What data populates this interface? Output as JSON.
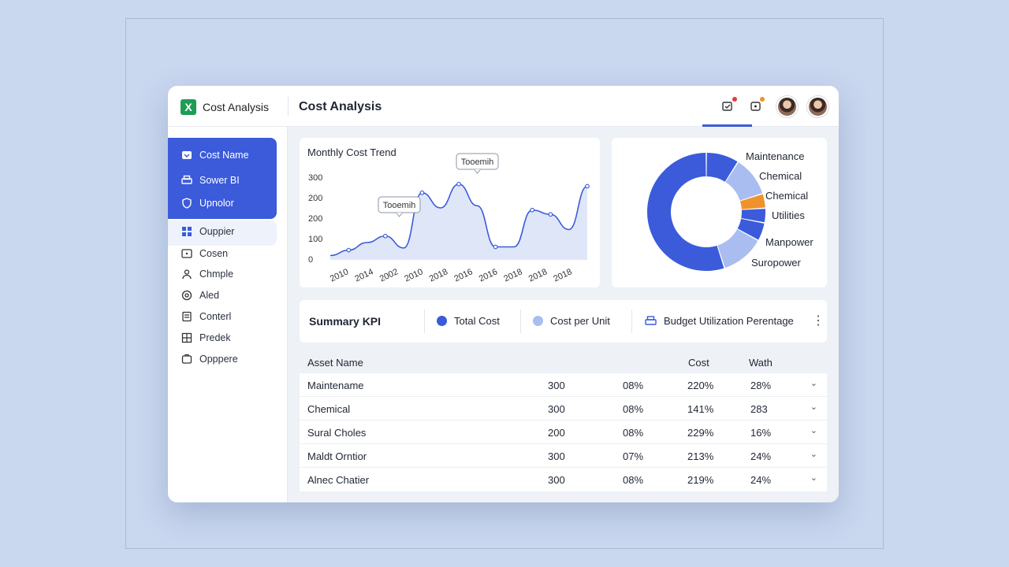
{
  "header": {
    "app_name": "Cost Analysis",
    "page_title": "Cost Analysis",
    "icons": [
      "checkbox-icon",
      "notification-icon"
    ],
    "accent": "#3b5bdb"
  },
  "sidebar": {
    "items": [
      {
        "label": "Cost Name",
        "icon": "tag-icon",
        "active": true
      },
      {
        "label": "Sower BI",
        "icon": "print-icon",
        "active": true
      },
      {
        "label": "Upnolor",
        "icon": "shield-icon",
        "active": true
      },
      {
        "label": "Ouppier",
        "icon": "grid-icon",
        "active": false
      },
      {
        "label": "Cosen",
        "icon": "plus-square-icon",
        "active": false
      },
      {
        "label": "Chmple",
        "icon": "user-icon",
        "active": false
      },
      {
        "label": "Aled",
        "icon": "badge-icon",
        "active": false
      },
      {
        "label": "Conterl",
        "icon": "doc-icon",
        "active": false
      },
      {
        "label": "Predek",
        "icon": "table-icon",
        "active": false
      },
      {
        "label": "Opppere",
        "icon": "box-icon",
        "active": false
      }
    ]
  },
  "trend_chart": {
    "title": "Monthly Cost Trend",
    "y_ticks": [
      "300",
      "200",
      "200",
      "100",
      "0"
    ],
    "x_ticks": [
      "2010",
      "2014",
      "2002",
      "2010",
      "2018",
      "2016",
      "2016",
      "2018",
      "2018",
      "2018"
    ],
    "tooltip_1": "Tooemih",
    "tooltip_2": "Tooemih",
    "line_color": "#3b5bdb"
  },
  "chart_data": {
    "type": "area",
    "x": [
      0,
      1,
      2,
      3,
      4,
      5,
      6,
      7,
      8,
      9,
      10,
      11,
      12,
      13,
      14
    ],
    "values": [
      20,
      45,
      80,
      110,
      55,
      310,
      240,
      350,
      250,
      60,
      60,
      230,
      210,
      140,
      340
    ],
    "ylim": [
      0,
      400
    ],
    "donut": {
      "segments": [
        {
          "label": "Maintenance",
          "value": 9,
          "color": "#3b5bdb"
        },
        {
          "label": "Chemical",
          "value": 11,
          "color": "#a9bdf0"
        },
        {
          "label": "Chemical",
          "value": 4,
          "color": "#f0922b"
        },
        {
          "label": "Utilities",
          "value": 4,
          "color": "#3b5bdb"
        },
        {
          "label": "",
          "value": 5,
          "color": "#3b5bdb"
        },
        {
          "label": "Manpower",
          "value": 12,
          "color": "#a9bdf0"
        },
        {
          "label": "Suropower",
          "value": 55,
          "color": "#3b5bdb"
        }
      ]
    }
  },
  "kpi": {
    "title": "Summary KPI",
    "items": [
      {
        "label": "Total Cost",
        "color": "#3b5bdb"
      },
      {
        "label": "Cost per Unit",
        "color": "#a9bdf0"
      },
      {
        "label": "Budget Utilization Perentage",
        "icon": "print-icon"
      }
    ]
  },
  "table": {
    "headers": [
      "Asset Name",
      "Cost",
      "Wath"
    ],
    "rows": [
      [
        "Maintename",
        "300",
        "08%",
        "220%",
        "28%"
      ],
      [
        "Chemical",
        "300",
        "08%",
        "141%",
        "283"
      ],
      [
        "Sural Choles",
        "200",
        "08%",
        "229%",
        "16%"
      ],
      [
        "Maldt Orntior",
        "300",
        "07%",
        "213%",
        "24%"
      ],
      [
        "Alnec Chatier",
        "300",
        "08%",
        "219%",
        "24%"
      ]
    ]
  }
}
